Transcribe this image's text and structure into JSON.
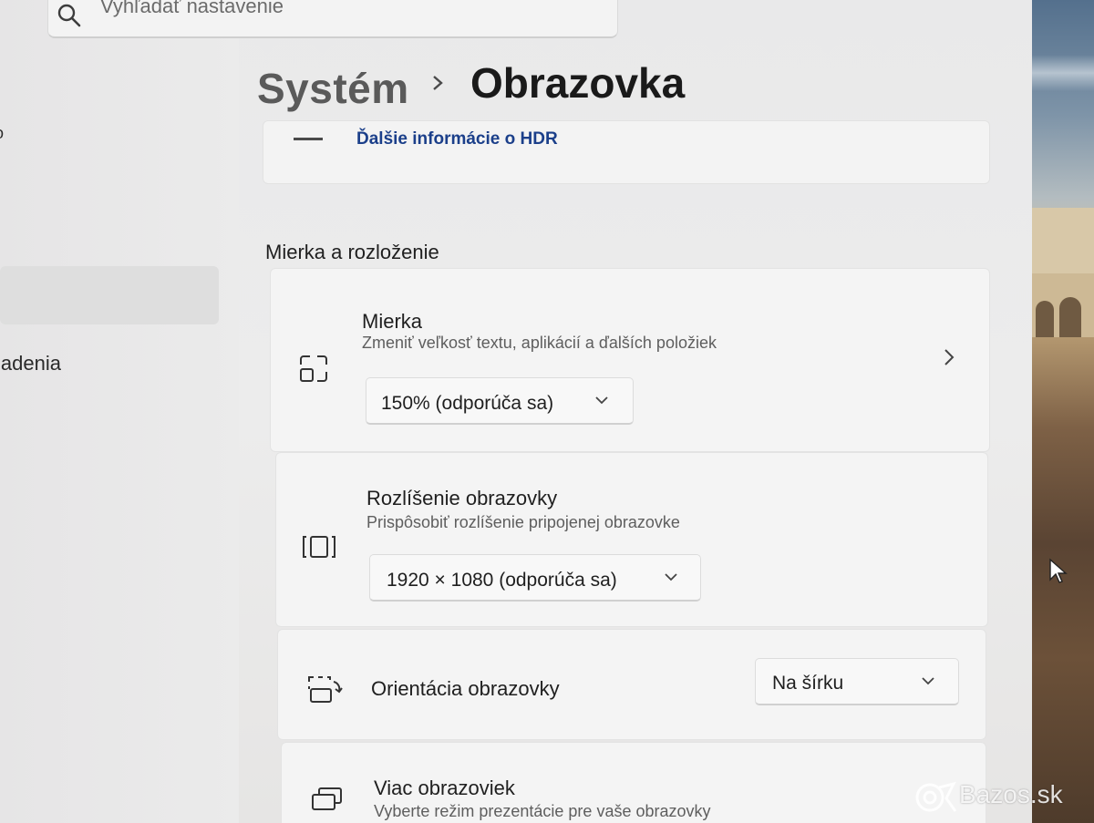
{
  "search": {
    "placeholder": "Vyhľadať nastavenie"
  },
  "nav": {
    "top_fragment": "o",
    "item_fragment": "iadenia"
  },
  "breadcrumb": {
    "parent": "Systém",
    "current": "Obrazovka"
  },
  "hdr": {
    "link": "Ďalšie informácie o HDR"
  },
  "section": {
    "title": "Mierka a rozloženie"
  },
  "scale": {
    "icon": "scale-icon",
    "title": "Mierka",
    "subtitle": "Zmeniť veľkosť textu, aplikácií a ďalších položiek",
    "value": "150% (odporúča sa)"
  },
  "resolution": {
    "icon": "resolution-icon",
    "title": "Rozlíšenie obrazovky",
    "subtitle": "Prispôsobiť rozlíšenie pripojenej obrazovke",
    "value": "1920 × 1080 (odporúča sa)"
  },
  "orientation": {
    "icon": "orientation-icon",
    "title": "Orientácia obrazovky",
    "value": "Na šírku"
  },
  "multiple": {
    "icon": "multiple-displays-icon",
    "title": "Viac obrazoviek",
    "subtitle": "Vyberte režim prezentácie pre vaše obrazovky"
  },
  "watermark": "Bazos.sk",
  "colors": {
    "accent_link": "#1b3f8a",
    "card_bg": "#f4f4f4",
    "page_bg": "#ececec"
  }
}
